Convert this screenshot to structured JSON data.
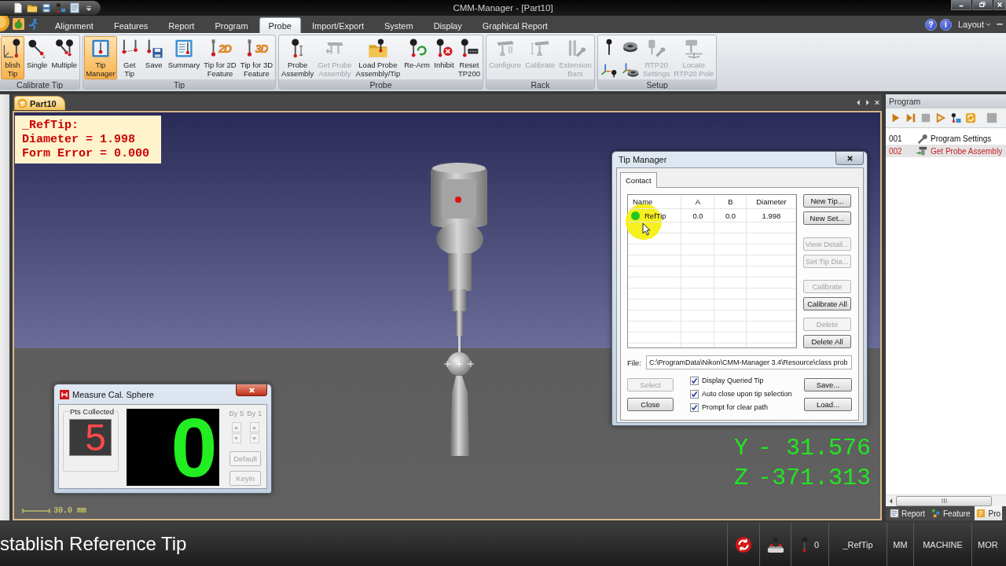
{
  "window": {
    "title": "CMM-Manager - [Part10]"
  },
  "ribbon": {
    "tabs": [
      {
        "label": "Alignment",
        "selected": false
      },
      {
        "label": "Features",
        "selected": false
      },
      {
        "label": "Report",
        "selected": false
      },
      {
        "label": "Program",
        "selected": false
      },
      {
        "label": "Probe",
        "selected": true
      },
      {
        "label": "Import/Export",
        "selected": false
      },
      {
        "label": "System",
        "selected": false
      },
      {
        "label": "Display",
        "selected": false
      },
      {
        "label": "Graphical Report",
        "selected": false
      }
    ],
    "help_buttons": [
      "?",
      "i"
    ],
    "layout_menu": "Layout",
    "groups": [
      {
        "title": "Calibrate Tip",
        "buttons": [
          {
            "kind": "large",
            "label": "blish\nTip",
            "selected": true,
            "disabled": false
          },
          {
            "kind": "large",
            "label": "Single",
            "selected": false,
            "disabled": false
          },
          {
            "kind": "large",
            "label": "Multiple",
            "selected": false,
            "disabled": false
          }
        ]
      },
      {
        "title": "Tip",
        "buttons": [
          {
            "kind": "large",
            "label": "Tip\nManager",
            "selected": true,
            "disabled": false
          },
          {
            "kind": "large",
            "label": "Get\nTip",
            "selected": false,
            "disabled": false
          },
          {
            "kind": "large",
            "label": "Save",
            "selected": false,
            "disabled": false
          },
          {
            "kind": "large",
            "label": "Summary",
            "selected": false,
            "disabled": false
          },
          {
            "kind": "large",
            "label": "Tip for 2D\nFeature",
            "badge": "2D",
            "selected": false,
            "disabled": false
          },
          {
            "kind": "large",
            "label": "Tip for 3D\nFeature",
            "badge": "3D",
            "selected": false,
            "disabled": false
          }
        ]
      },
      {
        "title": "Probe",
        "buttons": [
          {
            "kind": "large",
            "label": "Probe\nAssembly",
            "selected": false,
            "disabled": false
          },
          {
            "kind": "large",
            "label": "Get Probe\nAssembly",
            "selected": false,
            "disabled": true
          },
          {
            "kind": "large",
            "label": "Load Probe\nAssembly/Tip",
            "selected": false,
            "disabled": false
          },
          {
            "kind": "large",
            "label": "Re-Arm",
            "selected": false,
            "disabled": false
          },
          {
            "kind": "large",
            "label": "Inhibit",
            "selected": false,
            "disabled": false
          },
          {
            "kind": "large",
            "label": "Reset\nTP200",
            "selected": false,
            "disabled": false
          }
        ]
      },
      {
        "title": "Rack",
        "buttons": [
          {
            "kind": "large",
            "label": "Configure",
            "selected": false,
            "disabled": true
          },
          {
            "kind": "large",
            "label": "Calibrate",
            "selected": false,
            "disabled": true
          },
          {
            "kind": "large",
            "label": "Extension\nBars",
            "selected": false,
            "disabled": true
          }
        ]
      },
      {
        "title": "Setup",
        "buttons": [
          {
            "kind": "small_stack",
            "selected": false,
            "disabled": false
          },
          {
            "kind": "small_stack",
            "selected": false,
            "disabled": false
          },
          {
            "kind": "large",
            "label": "RTP20\nSettings",
            "selected": false,
            "disabled": true
          },
          {
            "kind": "large",
            "label": "Locate\nRTP20 Pole",
            "selected": false,
            "disabled": true
          }
        ]
      }
    ]
  },
  "document": {
    "tabs": [
      {
        "label": "Part10",
        "selected": true
      }
    ]
  },
  "viewport": {
    "annotation": [
      "_RefTip:",
      "Diameter = 1.998",
      "Form Error = 0.000"
    ],
    "readout": [
      {
        "axis": "Y",
        "value": "- 31.576"
      },
      {
        "axis": "Z",
        "value": "-371.313"
      }
    ],
    "scale": "30.0 mm"
  },
  "measure_dialog": {
    "title": "Measure Cal. Sphere",
    "group_label": "Pts Collected",
    "points_collected": "5",
    "count": "0",
    "steps": [
      {
        "label": "By 5",
        "disabled": true
      },
      {
        "label": "By 1",
        "disabled": true
      }
    ],
    "buttons": [
      {
        "label": "Default",
        "disabled": true
      },
      {
        "label": "Keyin",
        "disabled": true
      }
    ]
  },
  "tip_manager": {
    "title": "Tip Manager",
    "tabs": [
      {
        "label": "Contact",
        "selected": true
      }
    ],
    "columns": [
      "Name",
      "A",
      "B",
      "Diameter"
    ],
    "rows": [
      {
        "cells": [
          "RefTip",
          "0.0",
          "0.0",
          "1.998"
        ],
        "color": "#20c820"
      }
    ],
    "button_groups": [
      [
        {
          "label": "New Tip...",
          "disabled": false
        },
        {
          "label": "New Set...",
          "disabled": false
        }
      ],
      [
        {
          "label": "View Detail...",
          "disabled": true
        },
        {
          "label": "Set Tip Dia...",
          "disabled": true
        }
      ],
      [
        {
          "label": "Calibrate",
          "disabled": true
        },
        {
          "label": "Calibrate All",
          "disabled": false
        }
      ],
      [
        {
          "label": "Delete",
          "disabled": true
        },
        {
          "label": "Delete All",
          "disabled": false
        }
      ]
    ],
    "file_label": "File:",
    "file_path": "C:\\ProgramData\\Nikon\\CMM-Manager 3.4\\Resource\\class prob",
    "left_buttons": [
      {
        "label": "Select",
        "disabled": true
      },
      {
        "label": "Close",
        "disabled": false
      }
    ],
    "options": [
      {
        "label": "Display Queried Tip",
        "checked": true
      },
      {
        "label": "Auto close upon tip selection",
        "checked": true
      },
      {
        "label": "Prompt for clear path",
        "checked": true
      }
    ],
    "right_buttons": [
      {
        "label": "Save...",
        "disabled": false
      },
      {
        "label": "Load...",
        "disabled": false
      }
    ]
  },
  "program_panel": {
    "title": "Program",
    "steps": [
      {
        "number": "001",
        "label": "Program Settings",
        "selected": false
      },
      {
        "number": "002",
        "label": "Get Probe Assembly",
        "selected": true
      }
    ],
    "tabs": [
      {
        "label": "Report",
        "selected": false
      },
      {
        "label": "Feature",
        "selected": false
      },
      {
        "label": "Pro",
        "selected": true
      }
    ]
  },
  "status_bar": {
    "caption": "stablish Reference Tip",
    "probe_count": "0",
    "fields": [
      "_RefTip",
      "MM",
      "MACHINE",
      "MOR"
    ]
  }
}
